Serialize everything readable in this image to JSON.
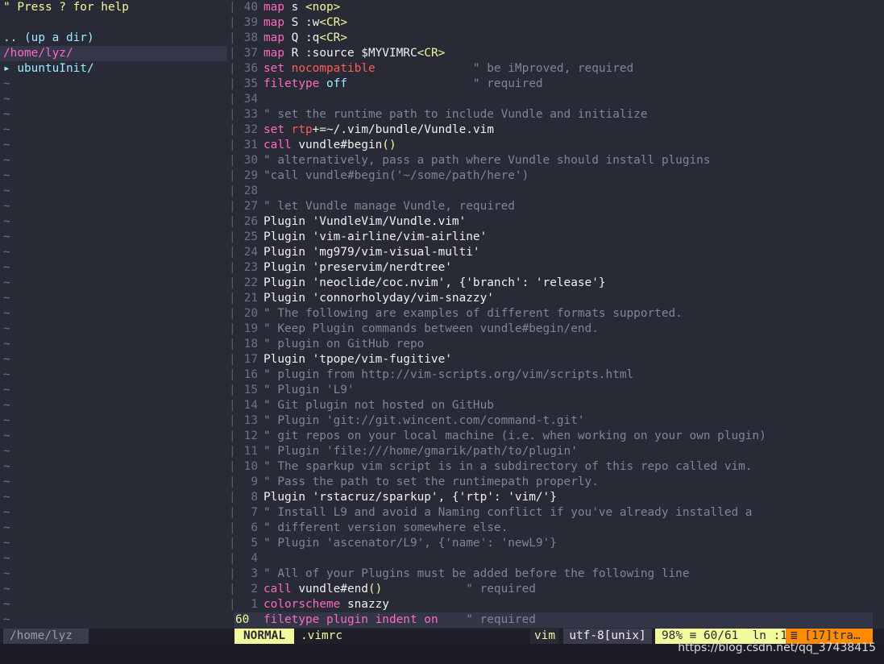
{
  "tree": {
    "help": "\" Press ? for help",
    "up": ".. (up a dir)",
    "root": "/home/lyz/",
    "dir": "▸ ubuntuInit/",
    "tilde": "~"
  },
  "lines": [
    {
      "n": "40",
      "t": [
        [
          "k",
          "map"
        ],
        [
          "w",
          " s "
        ],
        [
          "y",
          "<nop>"
        ]
      ]
    },
    {
      "n": "39",
      "t": [
        [
          "k",
          "map"
        ],
        [
          "w",
          " S :w"
        ],
        [
          "y",
          "<CR>"
        ]
      ]
    },
    {
      "n": "38",
      "t": [
        [
          "k",
          "map"
        ],
        [
          "w",
          " Q :q"
        ],
        [
          "y",
          "<CR>"
        ]
      ]
    },
    {
      "n": "37",
      "t": [
        [
          "k",
          "map"
        ],
        [
          "w",
          " R :source $MYVIMRC"
        ],
        [
          "y",
          "<CR>"
        ]
      ]
    },
    {
      "n": "36",
      "t": [
        [
          "k",
          "set"
        ],
        [
          "w",
          " "
        ],
        [
          "r",
          "nocompatible"
        ],
        [
          "c",
          "              \" be iMproved, required"
        ]
      ]
    },
    {
      "n": "35",
      "t": [
        [
          "k",
          "filetype"
        ],
        [
          "w",
          " "
        ],
        [
          "cy",
          "off"
        ],
        [
          "c",
          "                  \" required"
        ]
      ]
    },
    {
      "n": "34",
      "t": []
    },
    {
      "n": "33",
      "t": [
        [
          "c",
          "\" set the runtime path to include Vundle and initialize"
        ]
      ]
    },
    {
      "n": "32",
      "t": [
        [
          "k",
          "set"
        ],
        [
          "w",
          " "
        ],
        [
          "r",
          "rtp"
        ],
        [
          "w",
          "+=~/.vim/bundle/Vundle.vim"
        ]
      ]
    },
    {
      "n": "31",
      "t": [
        [
          "k",
          "call"
        ],
        [
          "w",
          " vundle#begin"
        ],
        [
          "y",
          "()"
        ]
      ]
    },
    {
      "n": "30",
      "t": [
        [
          "c",
          "\" alternatively, pass a path where Vundle should install plugins"
        ]
      ]
    },
    {
      "n": "29",
      "t": [
        [
          "c",
          "\"call vundle#begin('~/some/path/here')"
        ]
      ]
    },
    {
      "n": "28",
      "t": []
    },
    {
      "n": "27",
      "t": [
        [
          "c",
          "\" let Vundle manage Vundle, required"
        ]
      ]
    },
    {
      "n": "26",
      "t": [
        [
          "w",
          "Plugin 'VundleVim/Vundle.vim'"
        ]
      ]
    },
    {
      "n": "25",
      "t": [
        [
          "w",
          "Plugin 'vim-airline/vim-airline'"
        ]
      ]
    },
    {
      "n": "24",
      "t": [
        [
          "w",
          "Plugin 'mg979/vim-visual-multi'"
        ]
      ]
    },
    {
      "n": "23",
      "t": [
        [
          "w",
          "Plugin 'preservim/nerdtree'"
        ]
      ]
    },
    {
      "n": "22",
      "t": [
        [
          "w",
          "Plugin 'neoclide/coc.nvim', {'branch': 'release'}"
        ]
      ]
    },
    {
      "n": "21",
      "t": [
        [
          "w",
          "Plugin 'connorholyday/vim-snazzy'"
        ]
      ]
    },
    {
      "n": "20",
      "t": [
        [
          "c",
          "\" The following are examples of different formats supported."
        ]
      ]
    },
    {
      "n": "19",
      "t": [
        [
          "c",
          "\" Keep Plugin commands between vundle#begin/end."
        ]
      ]
    },
    {
      "n": "18",
      "t": [
        [
          "c",
          "\" plugin on GitHub repo"
        ]
      ]
    },
    {
      "n": "17",
      "t": [
        [
          "w",
          "Plugin 'tpope/vim-fugitive'"
        ]
      ]
    },
    {
      "n": "16",
      "t": [
        [
          "c",
          "\" plugin from http://vim-scripts.org/vim/scripts.html"
        ]
      ]
    },
    {
      "n": "15",
      "t": [
        [
          "c",
          "\" Plugin 'L9'"
        ]
      ]
    },
    {
      "n": "14",
      "t": [
        [
          "c",
          "\" Git plugin not hosted on GitHub"
        ]
      ]
    },
    {
      "n": "13",
      "t": [
        [
          "c",
          "\" Plugin 'git://git.wincent.com/command-t.git'"
        ]
      ]
    },
    {
      "n": "12",
      "t": [
        [
          "c",
          "\" git repos on your local machine (i.e. when working on your own plugin)"
        ]
      ]
    },
    {
      "n": "11",
      "t": [
        [
          "c",
          "\" Plugin 'file:///home/gmarik/path/to/plugin'"
        ]
      ]
    },
    {
      "n": "10",
      "t": [
        [
          "c",
          "\" The sparkup vim script is in a subdirectory of this repo called vim."
        ]
      ]
    },
    {
      "n": "9",
      "t": [
        [
          "c",
          "\" Pass the path to set the runtimepath properly."
        ]
      ]
    },
    {
      "n": "8",
      "t": [
        [
          "w",
          "Plugin 'rstacruz/sparkup', {'rtp': 'vim/'}"
        ]
      ]
    },
    {
      "n": "7",
      "t": [
        [
          "c",
          "\" Install L9 and avoid a Naming conflict if you've already installed a"
        ]
      ]
    },
    {
      "n": "6",
      "t": [
        [
          "c",
          "\" different version somewhere else."
        ]
      ]
    },
    {
      "n": "5",
      "t": [
        [
          "c",
          "\" Plugin 'ascenator/L9', {'name': 'newL9'}"
        ]
      ]
    },
    {
      "n": "4",
      "t": []
    },
    {
      "n": "3",
      "t": [
        [
          "c",
          "\" All of your Plugins must be added before the following line"
        ]
      ]
    },
    {
      "n": "2",
      "t": [
        [
          "k",
          "call"
        ],
        [
          "w",
          " vundle#end"
        ],
        [
          "y",
          "()"
        ],
        [
          "c",
          "            \" required"
        ]
      ]
    },
    {
      "n": "1",
      "t": [
        [
          "k",
          "colorscheme"
        ],
        [
          "w",
          " snazzy"
        ]
      ]
    },
    {
      "n": "60",
      "t": [
        [
          "k",
          "filetype"
        ],
        [
          "w",
          " "
        ],
        [
          "k",
          "plugin"
        ],
        [
          "w",
          " "
        ],
        [
          "k",
          "indent"
        ],
        [
          "w",
          " "
        ],
        [
          "k",
          "on"
        ],
        [
          "c",
          "    \" required"
        ]
      ],
      "current": true
    }
  ],
  "status": {
    "left_path": "/home/lyz",
    "mode": "NORMAL",
    "file": ".vimrc",
    "filetype": "vim",
    "encoding": "utf-8[unix]",
    "position": "98% ≡ 60/61  ln :1",
    "warn": "≣ [17]tra…"
  },
  "watermark": "https://blog.csdn.net/qq_37438415",
  "colors": {
    "bg": "#282a36",
    "pink": "#ff6ac1",
    "red": "#ff5c57",
    "yellow": "#f3f99d",
    "comment": "#7f8499",
    "cyan": "#9aedfe"
  }
}
